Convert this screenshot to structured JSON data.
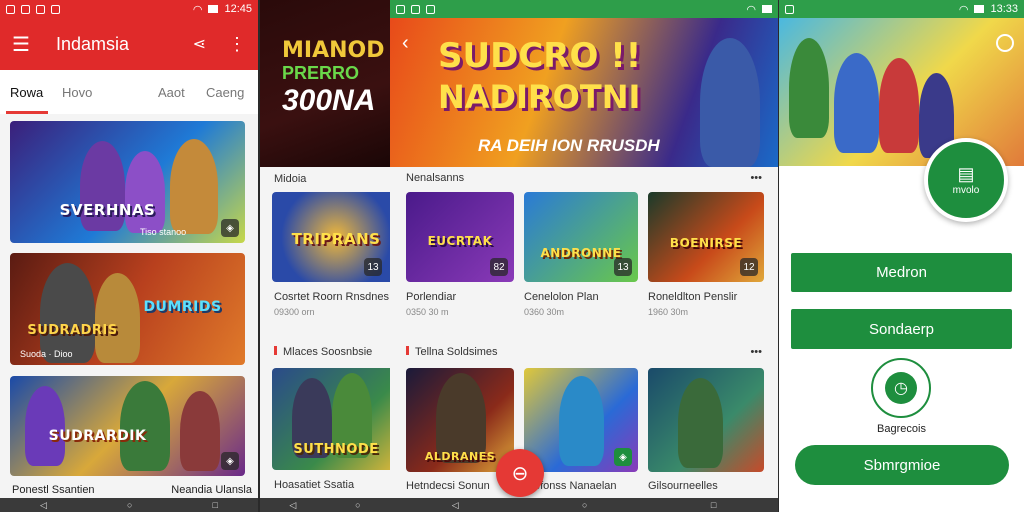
{
  "screen1": {
    "status_time": "12:45",
    "app_title": "Indamsia",
    "tabs": [
      "Rowa",
      "Hovo",
      "Aaot",
      "Caeng"
    ],
    "cards": [
      {
        "title": "SVERHNAS",
        "caption": "Tiso stanoo"
      },
      {
        "title": "SUDRADRIS",
        "caption": "Suoda · Dioo"
      },
      {
        "title": "SUDRARDIK",
        "caption": ""
      }
    ],
    "card2_right_title": "DUMRIDS",
    "footer": [
      "Ponestl Ssantien",
      "Neandia Ulansla"
    ]
  },
  "screen2": {
    "hero_lines": [
      "MIANOD",
      "PRERRO",
      "300NA"
    ],
    "section1": "Midoia",
    "card1_title": "TRIPRANS",
    "card1_label": "Cosrtet Roorn Rnsdnes",
    "card1_sub": "09300 orn",
    "section2": "Mlaces Soosnbsie",
    "card2_title": "SUTHNODE",
    "card2_label": "Hoasatiet Ssatia",
    "badge": "13"
  },
  "screen3": {
    "hero_line1": "SUDCRO !!",
    "hero_line2": "NADIROTNI",
    "hero_line3": "RA DEIH ION RRUSDH",
    "section1": "Nenalsanns",
    "section2": "Tellna Soldsimes",
    "cards_row1": [
      {
        "title": "EUCRTAK",
        "label": "Porlendiar",
        "sub": "0350 30 m",
        "badge": "82"
      },
      {
        "title": "ANDRONNE",
        "label": "Cenelolon Plan",
        "sub": "0360 30m",
        "badge": "13"
      },
      {
        "title": "BOENIRSE",
        "label": "Roneldlton Penslir",
        "sub": "1960 30m",
        "badge": "12"
      }
    ],
    "cards_row2": [
      {
        "title": "ALDRANES",
        "label": "Hetndecsi Sonun"
      },
      {
        "title": "",
        "label": "Trefonss Nanaelan"
      },
      {
        "title": "",
        "label": "Gilsourneelles"
      }
    ],
    "fab_icon": "cart-icon"
  },
  "screen4": {
    "status_time": "13:33",
    "logo_text": "mvolo",
    "buttons": [
      "Medron",
      "Sondaerp"
    ],
    "icon_label": "Bagrecois",
    "bottom_button": "Sbmrgmioe",
    "accent": "#1e8e3e"
  },
  "colors": {
    "red": "#e53935",
    "green": "#1e8e3e",
    "status_green": "#2e9e4a"
  }
}
